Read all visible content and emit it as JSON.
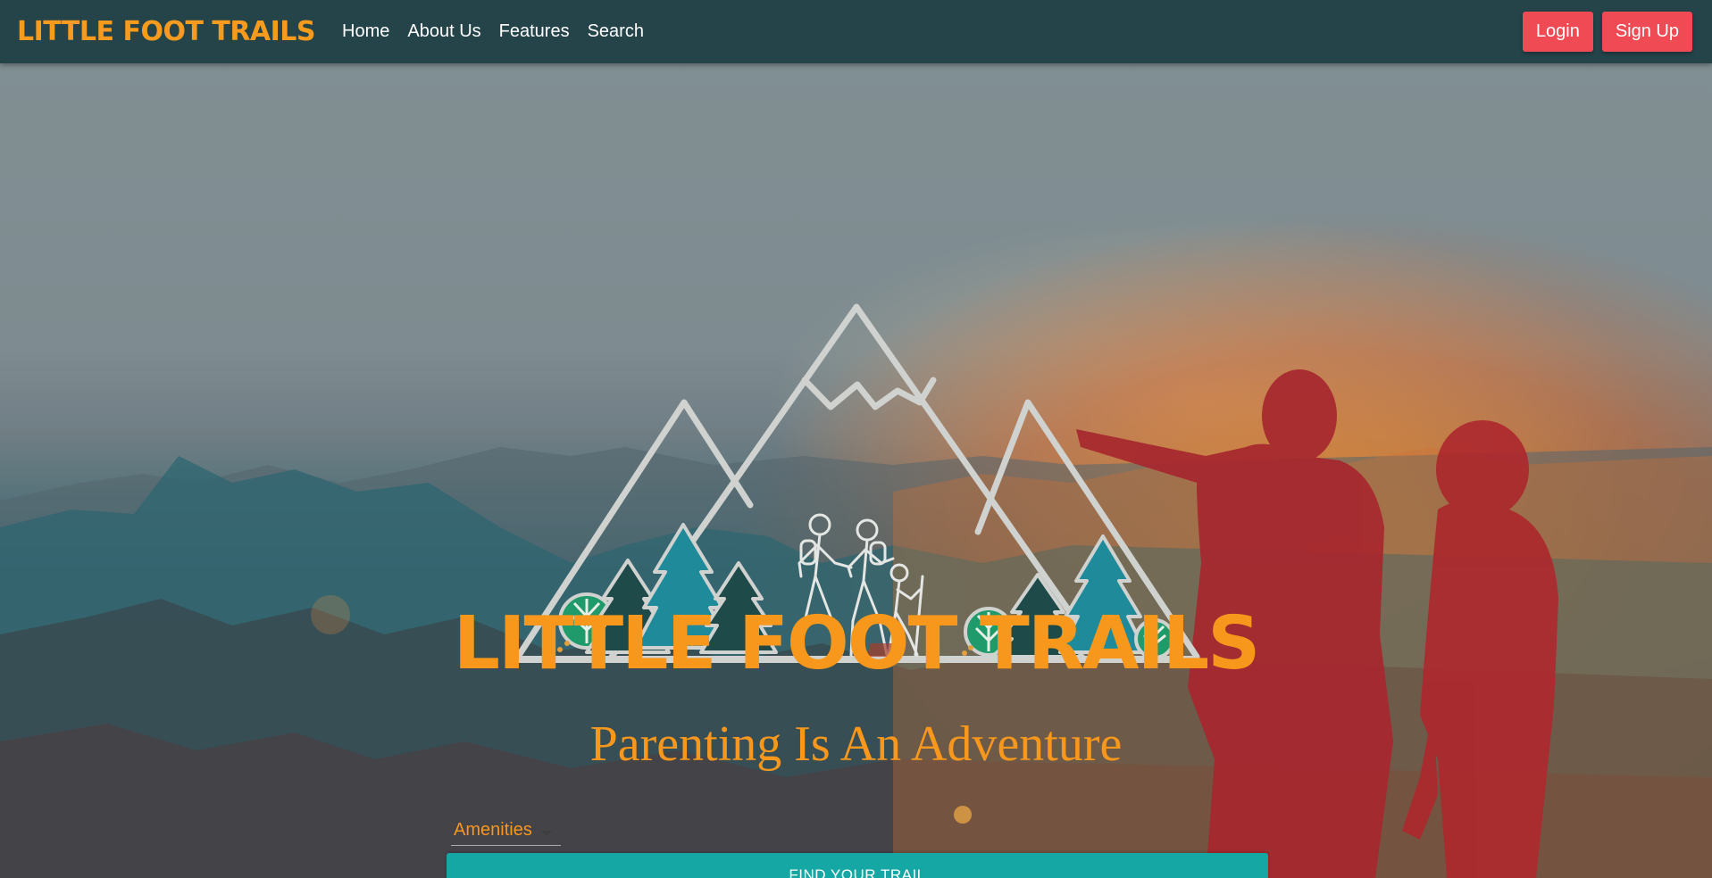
{
  "navbar": {
    "brand": "LITTLE FOOT TRAILS",
    "links": [
      "Home",
      "About Us",
      "Features",
      "Search"
    ],
    "login_label": "Login",
    "signup_label": "Sign Up"
  },
  "hero": {
    "logo_title": "LITTLE FOOT TRAILS",
    "tagline": "Parenting Is An Adventure",
    "amenities_label": "Amenities",
    "find_button_label": "FIND YOUR TRAIL"
  },
  "colors": {
    "navbar_bg": "#24444a",
    "brand_orange": "#f7971c",
    "button_red": "#f04a55",
    "button_teal": "#14a7a3",
    "tree_teal": "#1f8a9a",
    "tree_dark": "#1f4a4a",
    "tree_green": "#1f9a6a"
  },
  "icons": [
    "mountain-logo-icon",
    "dropdown-caret-icon"
  ]
}
